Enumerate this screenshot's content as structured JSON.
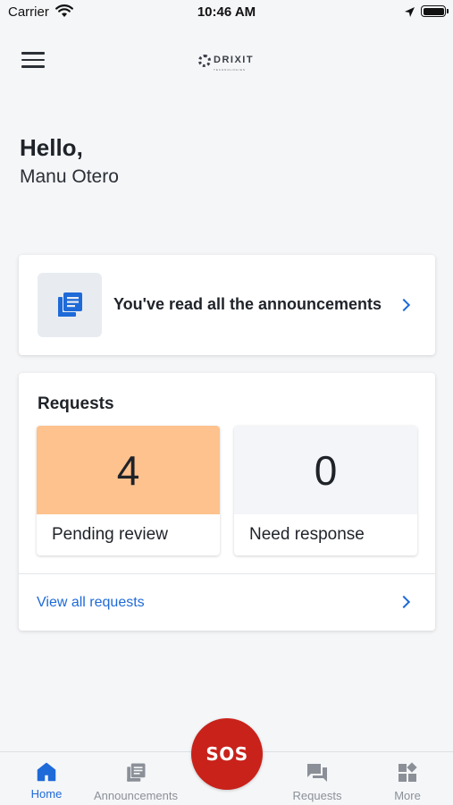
{
  "status_bar": {
    "carrier": "Carrier",
    "time": "10:46 AM"
  },
  "header": {
    "logo_text": "DRIXIT",
    "logo_subtext": "TECHNOLOGIES"
  },
  "greeting": {
    "hello": "Hello,",
    "name": "Manu Otero"
  },
  "announcements_card": {
    "text": "You've read all the announcements",
    "icon": "announcements-icon"
  },
  "requests_card": {
    "title": "Requests",
    "tiles": [
      {
        "count": "4",
        "label": "Pending review",
        "color": "#fdc28d"
      },
      {
        "count": "0",
        "label": "Need response",
        "color": "#f3f5f8"
      }
    ],
    "view_all": "View all requests"
  },
  "sos": {
    "label": "SOS",
    "color": "#c8221a"
  },
  "tab_bar": {
    "active": "Home",
    "tabs": [
      {
        "label": "Home",
        "icon": "home-icon"
      },
      {
        "label": "Announcements",
        "icon": "announcements-icon"
      },
      {
        "label": "Requests",
        "icon": "chat-icon"
      },
      {
        "label": "More",
        "icon": "apps-icon"
      }
    ]
  },
  "colors": {
    "accent": "#1e6ad8",
    "background": "#f5f6f8"
  }
}
